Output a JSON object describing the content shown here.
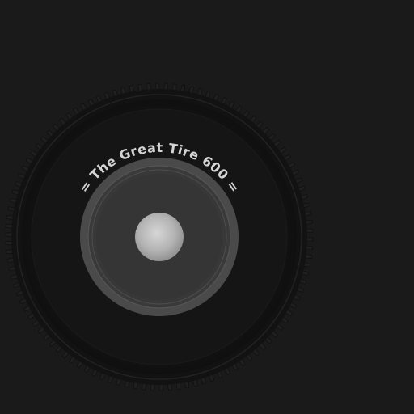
{
  "tire": {
    "brand_text": "= The Great Tire 600 ="
  },
  "colors": {
    "background": "#1a1a1a",
    "tread": "#141414",
    "sidewall": "#111111",
    "sidewall_inner": "#1c1c1c",
    "rim_outer": "#4a4a4a",
    "rim_inner": "#363636",
    "hub_light": "#d0d0d0",
    "hub_dark": "#9a9a9a",
    "label": "#d4d4d4"
  }
}
